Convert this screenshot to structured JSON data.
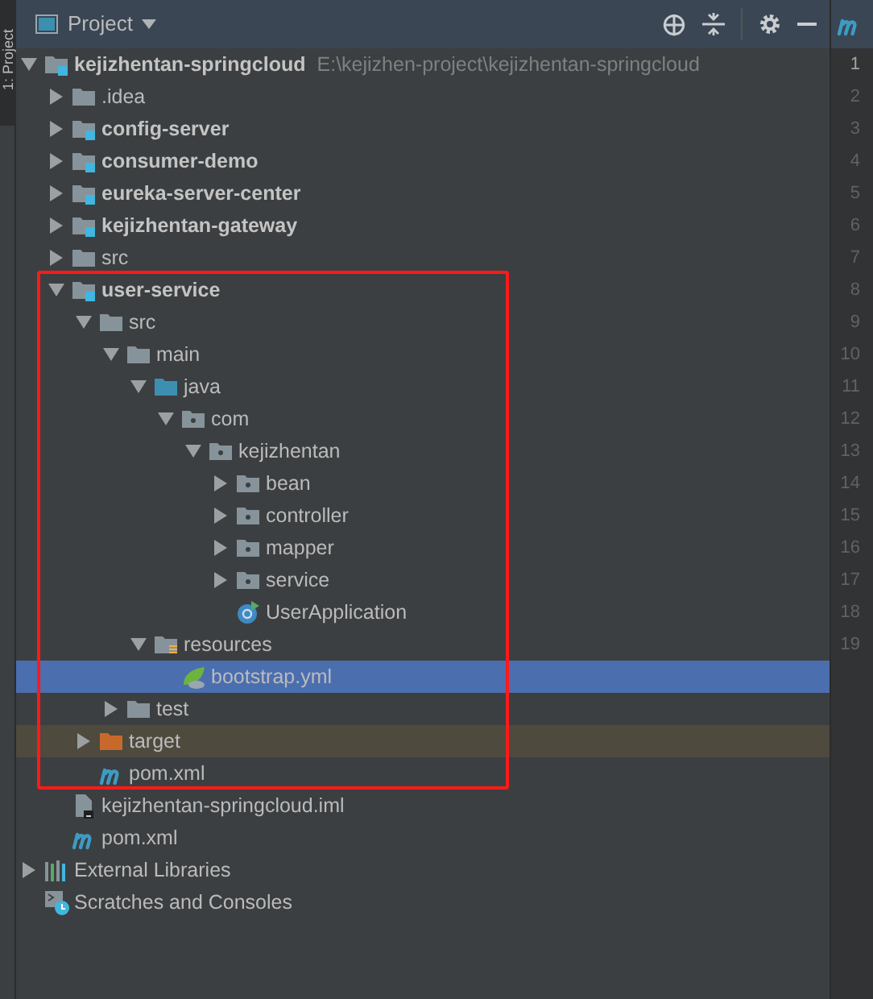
{
  "side_tab": {
    "label": "1: Project",
    "selected": true
  },
  "toolwindow": {
    "title": "Project"
  },
  "editor_tab": {
    "kind": "maven"
  },
  "tree": [
    {
      "label": "kejizhentan-springcloud",
      "kind": "module",
      "bold": true,
      "hint": "E:\\kejizhen-project\\kejizhentan-springcloud",
      "expanded": true,
      "selected": false,
      "children": [
        {
          "label": ".idea",
          "kind": "folder",
          "bold": false,
          "expanded": false,
          "selected": false
        },
        {
          "label": "config-server",
          "kind": "module",
          "bold": true,
          "expanded": false,
          "selected": false
        },
        {
          "label": "consumer-demo",
          "kind": "module",
          "bold": true,
          "expanded": false,
          "selected": false
        },
        {
          "label": "eureka-server-center",
          "kind": "module",
          "bold": true,
          "expanded": false,
          "selected": false
        },
        {
          "label": "kejizhentan-gateway",
          "kind": "module",
          "bold": true,
          "expanded": false,
          "selected": false
        },
        {
          "label": "src",
          "kind": "folder",
          "bold": false,
          "expanded": false,
          "selected": false
        },
        {
          "label": "user-service",
          "kind": "module",
          "bold": true,
          "expanded": true,
          "selected": false,
          "children": [
            {
              "label": "src",
              "kind": "folder",
              "bold": false,
              "expanded": true,
              "selected": false,
              "children": [
                {
                  "label": "main",
                  "kind": "folder",
                  "bold": false,
                  "expanded": true,
                  "selected": false,
                  "children": [
                    {
                      "label": "java",
                      "kind": "source",
                      "bold": false,
                      "expanded": true,
                      "selected": false,
                      "children": [
                        {
                          "label": "com",
                          "kind": "package",
                          "bold": false,
                          "expanded": true,
                          "selected": false,
                          "children": [
                            {
                              "label": "kejizhentan",
                              "kind": "package",
                              "bold": false,
                              "expanded": true,
                              "selected": false,
                              "children": [
                                {
                                  "label": "bean",
                                  "kind": "package",
                                  "bold": false,
                                  "expanded": false,
                                  "selected": false
                                },
                                {
                                  "label": "controller",
                                  "kind": "package",
                                  "bold": false,
                                  "expanded": false,
                                  "selected": false
                                },
                                {
                                  "label": "mapper",
                                  "kind": "package",
                                  "bold": false,
                                  "expanded": false,
                                  "selected": false
                                },
                                {
                                  "label": "service",
                                  "kind": "package",
                                  "bold": false,
                                  "expanded": false,
                                  "selected": false
                                },
                                {
                                  "label": "UserApplication",
                                  "kind": "class",
                                  "bold": false,
                                  "selected": false
                                }
                              ]
                            }
                          ]
                        }
                      ]
                    },
                    {
                      "label": "resources",
                      "kind": "resources",
                      "bold": false,
                      "expanded": true,
                      "selected": false,
                      "children": [
                        {
                          "label": "bootstrap.yml",
                          "kind": "spring",
                          "bold": false,
                          "selected": true
                        }
                      ]
                    }
                  ]
                },
                {
                  "label": "test",
                  "kind": "folder",
                  "bold": false,
                  "expanded": false,
                  "selected": false
                }
              ]
            },
            {
              "label": "target",
              "kind": "excluded",
              "bold": false,
              "expanded": false,
              "selected": false
            },
            {
              "label": "pom.xml",
              "kind": "maven",
              "bold": false,
              "selected": false
            }
          ]
        },
        {
          "label": "kejizhentan-springcloud.iml",
          "kind": "iml",
          "bold": false,
          "selected": false
        },
        {
          "label": "pom.xml",
          "kind": "maven",
          "bold": false,
          "selected": false
        }
      ]
    },
    {
      "label": "External Libraries",
      "kind": "libraries",
      "bold": false,
      "expanded": false,
      "selected": false
    },
    {
      "label": "Scratches and Consoles",
      "kind": "scratches",
      "bold": false,
      "selected": false
    }
  ],
  "line_numbers": [
    "1",
    "2",
    "3",
    "4",
    "5",
    "6",
    "7",
    "8",
    "9",
    "10",
    "11",
    "12",
    "13",
    "14",
    "15",
    "16",
    "17",
    "18",
    "19"
  ]
}
